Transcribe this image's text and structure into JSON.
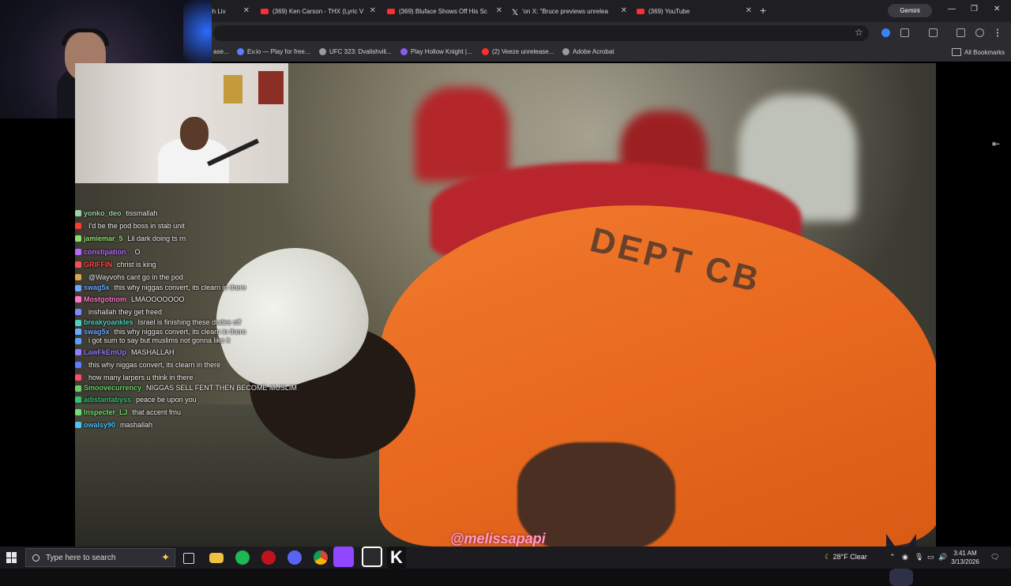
{
  "browser": {
    "tabs": [
      {
        "title": "atch Liv",
        "icon": "youtube"
      },
      {
        "title": "(369) Ken Carson - THX (Lyric V",
        "icon": "youtube"
      },
      {
        "title": "(369) Bluface Shows Off His Sc",
        "icon": "youtube"
      },
      {
        "title": "'on X: \"Bruce previews unrelea",
        "icon": "x"
      },
      {
        "title": "(369) YouTube",
        "icon": "youtube"
      }
    ],
    "tab_close": "✕",
    "new_tab": "+",
    "gemini_label": "Gemini",
    "bookmarks": [
      {
        "label": "ase..."
      },
      {
        "label": "Ev.io — Play for free..."
      },
      {
        "label": "UFC 323: Dvalishvili..."
      },
      {
        "label": "Play Hollow Knight |..."
      },
      {
        "label": "(2) Veeze unrelease..."
      },
      {
        "label": "Adobe Acrobat"
      }
    ],
    "all_bookmarks": "All Bookmarks"
  },
  "video": {
    "shirt_print": "DEPT CB"
  },
  "chat": {
    "messages": [
      {
        "user": "yonko_deo",
        "text": "tissmallah",
        "color": "#9bd3a4"
      },
      {
        "user": "",
        "text": "I'd be the pod boss in stab unit",
        "color": "#ff3b30"
      },
      {
        "user": "jamiemar_5",
        "text": "Lil dark doing ts rn",
        "color": "#8ee06e"
      },
      {
        "user": "constipation_",
        "text": "O",
        "color": "#b66bff"
      },
      {
        "user": "GRIFFIN",
        "text": "christ is king",
        "color": "#ff4d4d"
      },
      {
        "user": "",
        "text": "@Wayvohs cant go in the pod",
        "color": "#d9a84e"
      },
      {
        "user": "swag5x",
        "text": "this why niggas convert, its clearn in there",
        "color": "#6ea8ff"
      },
      {
        "user": "Mostgotnom",
        "text": "LMAOOOOOOO",
        "color": "#ff77c8"
      },
      {
        "user": "",
        "text": "inshallah they get freed",
        "color": "#7a8cff"
      },
      {
        "user": "breakyoankles",
        "text": "Israel is finishing these dudes off",
        "color": "#4fd0c0"
      },
      {
        "user": "swag5x",
        "text": "this why niggas convert, its clearn in there",
        "color": "#6ea8ff"
      },
      {
        "user": "",
        "text": "i got sum to say but muslims not gonna like it",
        "color": "#5aa0ff"
      },
      {
        "user": "LawFkEmUp",
        "text": "MASHALLAH",
        "color": "#8f7dff"
      },
      {
        "user": "",
        "text": "this why niggas convert, its clearn in there",
        "color": "#5b7dff"
      },
      {
        "user": "",
        "text": "how many larpers u think in there",
        "color": "#ff4d6d"
      },
      {
        "user": "Smoovecurrency",
        "text": "NIGGAS SELL FENT THEN BECOME MUSLIM",
        "color": "#6ad06a"
      },
      {
        "user": "adistantabyss",
        "text": "peace be upon you",
        "color": "#37c07a"
      },
      {
        "user": "Inspecter_LJ",
        "text": "that accent fmu",
        "color": "#70e070"
      },
      {
        "user": "owalsy90",
        "text": "mashallah",
        "color": "#4fc3f7"
      }
    ]
  },
  "overlay": {
    "watermark": "@melissapapi"
  },
  "taskbar": {
    "search_placeholder": "Type here to search",
    "weather": "28°F  Clear",
    "time": "3:41 AM",
    "date": "3/13/2026"
  }
}
